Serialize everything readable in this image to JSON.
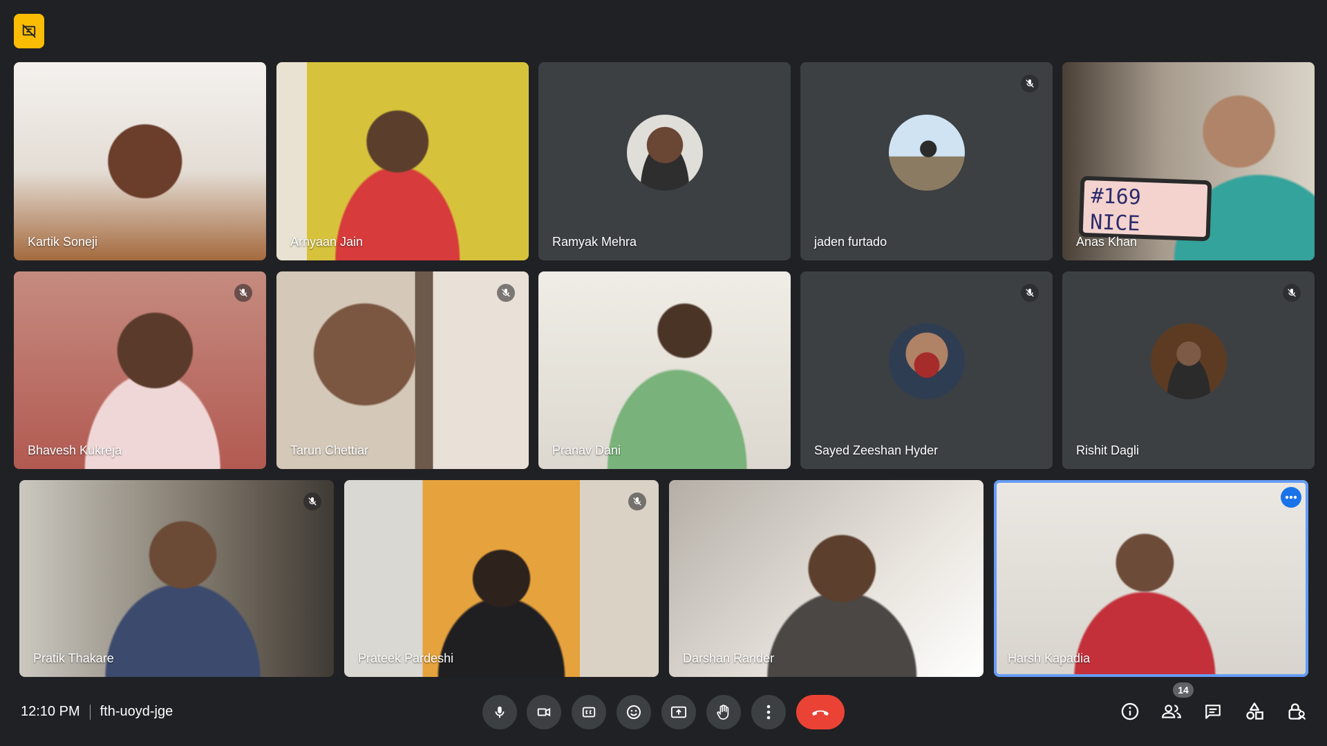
{
  "meeting": {
    "time": "12:10 PM",
    "code": "fth-uoyd-jge"
  },
  "participant_count": "14",
  "participants": [
    {
      "name": "Kartik Soneji",
      "muted": false,
      "camera": "on"
    },
    {
      "name": "Arnyaan Jain",
      "muted": false,
      "camera": "on"
    },
    {
      "name": "Ramyak Mehra",
      "muted": false,
      "camera": "off"
    },
    {
      "name": "jaden furtado",
      "muted": true,
      "camera": "off"
    },
    {
      "name": "Anas Khan",
      "muted": false,
      "camera": "on",
      "sign_text": "#169 NICE"
    },
    {
      "name": "Bhavesh Kukreja",
      "muted": true,
      "camera": "on"
    },
    {
      "name": "Tarun Chettiar",
      "muted": true,
      "camera": "on"
    },
    {
      "name": "Pranav Dani",
      "muted": false,
      "camera": "on"
    },
    {
      "name": "Sayed Zeeshan Hyder",
      "muted": true,
      "camera": "off"
    },
    {
      "name": "Rishit Dagli",
      "muted": true,
      "camera": "off"
    },
    {
      "name": "Pratik Thakare",
      "muted": true,
      "camera": "on"
    },
    {
      "name": "Prateek Pardeshi",
      "muted": true,
      "camera": "on"
    },
    {
      "name": "Darshan Rander",
      "muted": false,
      "camera": "on"
    },
    {
      "name": "Harsh Kapadia",
      "muted": false,
      "camera": "on",
      "active_speaker": true
    }
  ],
  "controls": [
    {
      "name": "microphone",
      "icon": "mic-icon"
    },
    {
      "name": "camera",
      "icon": "video-camera-icon"
    },
    {
      "name": "captions",
      "icon": "closed-captions-icon"
    },
    {
      "name": "reactions",
      "icon": "emoji-icon"
    },
    {
      "name": "present",
      "icon": "present-screen-icon"
    },
    {
      "name": "raise-hand",
      "icon": "hand-icon"
    },
    {
      "name": "more-options",
      "icon": "more-vert-icon"
    },
    {
      "name": "leave-call",
      "icon": "end-call-icon"
    }
  ],
  "side_controls": [
    {
      "name": "meeting-details",
      "icon": "info-icon"
    },
    {
      "name": "people",
      "icon": "people-icon"
    },
    {
      "name": "chat",
      "icon": "chat-icon"
    },
    {
      "name": "activities",
      "icon": "activities-icon"
    },
    {
      "name": "host-controls",
      "icon": "lock-person-icon"
    }
  ],
  "colors": {
    "background": "#202124",
    "tile": "#3c4043",
    "end_call": "#ea4335",
    "active_outline": "#669df6",
    "badge": "#fbbc04"
  }
}
